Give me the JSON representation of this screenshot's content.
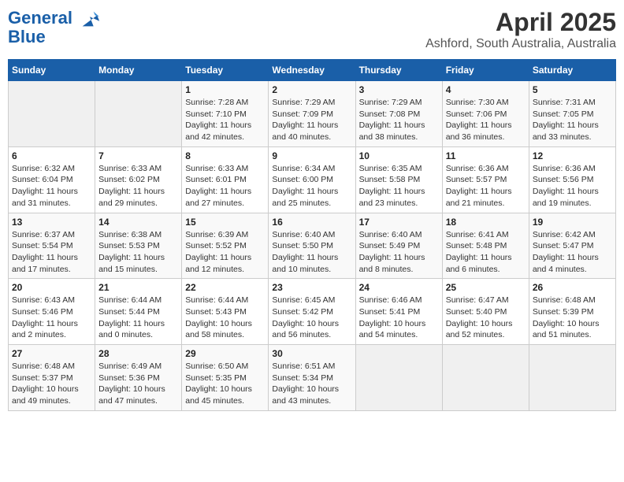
{
  "header": {
    "logo_line1": "General",
    "logo_line2": "Blue",
    "title": "April 2025",
    "subtitle": "Ashford, South Australia, Australia"
  },
  "weekdays": [
    "Sunday",
    "Monday",
    "Tuesday",
    "Wednesday",
    "Thursday",
    "Friday",
    "Saturday"
  ],
  "weeks": [
    [
      {
        "day": "",
        "empty": true
      },
      {
        "day": "",
        "empty": true
      },
      {
        "day": "1",
        "sunrise": "Sunrise: 7:28 AM",
        "sunset": "Sunset: 7:10 PM",
        "daylight": "Daylight: 11 hours and 42 minutes."
      },
      {
        "day": "2",
        "sunrise": "Sunrise: 7:29 AM",
        "sunset": "Sunset: 7:09 PM",
        "daylight": "Daylight: 11 hours and 40 minutes."
      },
      {
        "day": "3",
        "sunrise": "Sunrise: 7:29 AM",
        "sunset": "Sunset: 7:08 PM",
        "daylight": "Daylight: 11 hours and 38 minutes."
      },
      {
        "day": "4",
        "sunrise": "Sunrise: 7:30 AM",
        "sunset": "Sunset: 7:06 PM",
        "daylight": "Daylight: 11 hours and 36 minutes."
      },
      {
        "day": "5",
        "sunrise": "Sunrise: 7:31 AM",
        "sunset": "Sunset: 7:05 PM",
        "daylight": "Daylight: 11 hours and 33 minutes."
      }
    ],
    [
      {
        "day": "6",
        "sunrise": "Sunrise: 6:32 AM",
        "sunset": "Sunset: 6:04 PM",
        "daylight": "Daylight: 11 hours and 31 minutes."
      },
      {
        "day": "7",
        "sunrise": "Sunrise: 6:33 AM",
        "sunset": "Sunset: 6:02 PM",
        "daylight": "Daylight: 11 hours and 29 minutes."
      },
      {
        "day": "8",
        "sunrise": "Sunrise: 6:33 AM",
        "sunset": "Sunset: 6:01 PM",
        "daylight": "Daylight: 11 hours and 27 minutes."
      },
      {
        "day": "9",
        "sunrise": "Sunrise: 6:34 AM",
        "sunset": "Sunset: 6:00 PM",
        "daylight": "Daylight: 11 hours and 25 minutes."
      },
      {
        "day": "10",
        "sunrise": "Sunrise: 6:35 AM",
        "sunset": "Sunset: 5:58 PM",
        "daylight": "Daylight: 11 hours and 23 minutes."
      },
      {
        "day": "11",
        "sunrise": "Sunrise: 6:36 AM",
        "sunset": "Sunset: 5:57 PM",
        "daylight": "Daylight: 11 hours and 21 minutes."
      },
      {
        "day": "12",
        "sunrise": "Sunrise: 6:36 AM",
        "sunset": "Sunset: 5:56 PM",
        "daylight": "Daylight: 11 hours and 19 minutes."
      }
    ],
    [
      {
        "day": "13",
        "sunrise": "Sunrise: 6:37 AM",
        "sunset": "Sunset: 5:54 PM",
        "daylight": "Daylight: 11 hours and 17 minutes."
      },
      {
        "day": "14",
        "sunrise": "Sunrise: 6:38 AM",
        "sunset": "Sunset: 5:53 PM",
        "daylight": "Daylight: 11 hours and 15 minutes."
      },
      {
        "day": "15",
        "sunrise": "Sunrise: 6:39 AM",
        "sunset": "Sunset: 5:52 PM",
        "daylight": "Daylight: 11 hours and 12 minutes."
      },
      {
        "day": "16",
        "sunrise": "Sunrise: 6:40 AM",
        "sunset": "Sunset: 5:50 PM",
        "daylight": "Daylight: 11 hours and 10 minutes."
      },
      {
        "day": "17",
        "sunrise": "Sunrise: 6:40 AM",
        "sunset": "Sunset: 5:49 PM",
        "daylight": "Daylight: 11 hours and 8 minutes."
      },
      {
        "day": "18",
        "sunrise": "Sunrise: 6:41 AM",
        "sunset": "Sunset: 5:48 PM",
        "daylight": "Daylight: 11 hours and 6 minutes."
      },
      {
        "day": "19",
        "sunrise": "Sunrise: 6:42 AM",
        "sunset": "Sunset: 5:47 PM",
        "daylight": "Daylight: 11 hours and 4 minutes."
      }
    ],
    [
      {
        "day": "20",
        "sunrise": "Sunrise: 6:43 AM",
        "sunset": "Sunset: 5:46 PM",
        "daylight": "Daylight: 11 hours and 2 minutes."
      },
      {
        "day": "21",
        "sunrise": "Sunrise: 6:44 AM",
        "sunset": "Sunset: 5:44 PM",
        "daylight": "Daylight: 11 hours and 0 minutes."
      },
      {
        "day": "22",
        "sunrise": "Sunrise: 6:44 AM",
        "sunset": "Sunset: 5:43 PM",
        "daylight": "Daylight: 10 hours and 58 minutes."
      },
      {
        "day": "23",
        "sunrise": "Sunrise: 6:45 AM",
        "sunset": "Sunset: 5:42 PM",
        "daylight": "Daylight: 10 hours and 56 minutes."
      },
      {
        "day": "24",
        "sunrise": "Sunrise: 6:46 AM",
        "sunset": "Sunset: 5:41 PM",
        "daylight": "Daylight: 10 hours and 54 minutes."
      },
      {
        "day": "25",
        "sunrise": "Sunrise: 6:47 AM",
        "sunset": "Sunset: 5:40 PM",
        "daylight": "Daylight: 10 hours and 52 minutes."
      },
      {
        "day": "26",
        "sunrise": "Sunrise: 6:48 AM",
        "sunset": "Sunset: 5:39 PM",
        "daylight": "Daylight: 10 hours and 51 minutes."
      }
    ],
    [
      {
        "day": "27",
        "sunrise": "Sunrise: 6:48 AM",
        "sunset": "Sunset: 5:37 PM",
        "daylight": "Daylight: 10 hours and 49 minutes."
      },
      {
        "day": "28",
        "sunrise": "Sunrise: 6:49 AM",
        "sunset": "Sunset: 5:36 PM",
        "daylight": "Daylight: 10 hours and 47 minutes."
      },
      {
        "day": "29",
        "sunrise": "Sunrise: 6:50 AM",
        "sunset": "Sunset: 5:35 PM",
        "daylight": "Daylight: 10 hours and 45 minutes."
      },
      {
        "day": "30",
        "sunrise": "Sunrise: 6:51 AM",
        "sunset": "Sunset: 5:34 PM",
        "daylight": "Daylight: 10 hours and 43 minutes."
      },
      {
        "day": "",
        "empty": true
      },
      {
        "day": "",
        "empty": true
      },
      {
        "day": "",
        "empty": true
      }
    ]
  ]
}
